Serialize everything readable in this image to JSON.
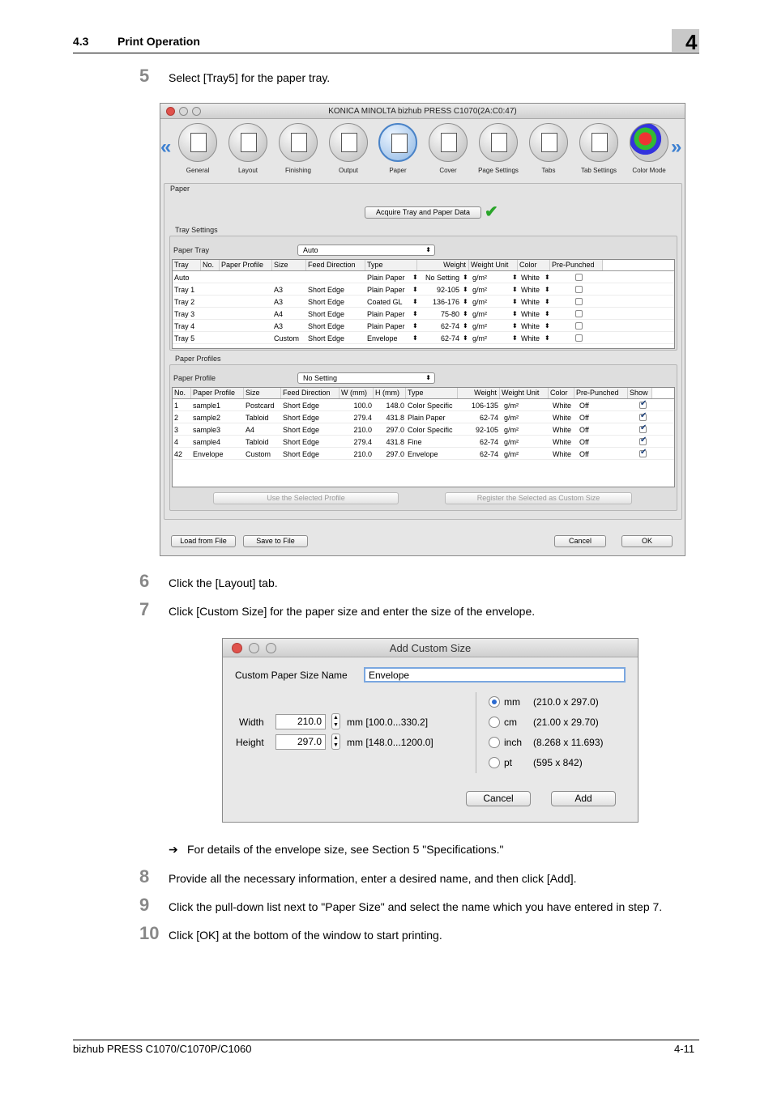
{
  "header": {
    "section": "4.3",
    "title": "Print Operation",
    "chapter": "4"
  },
  "steps": [
    {
      "num": "5",
      "text": "Select [Tray5] for the paper tray."
    },
    {
      "num": "6",
      "text": "Click the [Layout] tab."
    },
    {
      "num": "7",
      "text": "Click [Custom Size] for the paper size and enter the size of the envelope."
    },
    {
      "num": "8",
      "text": "Provide all the necessary information, enter a desired name, and then click [Add]."
    },
    {
      "num": "9",
      "text": "Click the pull-down list next to \"Paper Size\" and select the name which you have entered in step 7."
    },
    {
      "num": "10",
      "text": "Click [OK] at the bottom of the window to start printing."
    }
  ],
  "note": {
    "arrow": "➔",
    "text": "For details of the envelope size, see Section 5 \"Specifications.\""
  },
  "window": {
    "title": "KONICA MINOLTA bizhub PRESS C1070(2A:C0:47)",
    "tabs": [
      "General",
      "Layout",
      "Finishing",
      "Output",
      "Paper",
      "Cover",
      "Page Settings",
      "Tabs",
      "Tab Settings",
      "Color Mode"
    ],
    "selected_tab": "Paper",
    "paper_group": "Paper",
    "acquire_button": "Acquire Tray and Paper Data",
    "tray_settings_label": "Tray Settings",
    "paper_tray_label": "Paper Tray",
    "paper_tray_value": "Auto",
    "tray_columns": [
      "Tray",
      "No.",
      "Paper Profile",
      "Size",
      "Feed Direction",
      "Type",
      "Weight",
      "Weight Unit",
      "Color",
      "Pre-Punched"
    ],
    "tray_rows": [
      {
        "tray": "Auto",
        "no": "",
        "profile": "",
        "size": "",
        "feed": "",
        "type": "Plain Paper",
        "weight": "No Setting",
        "unit": "g/m²",
        "color": "White"
      },
      {
        "tray": "Tray 1",
        "no": "",
        "profile": "",
        "size": "A3",
        "feed": "Short Edge",
        "type": "Plain Paper",
        "weight": "92-105",
        "unit": "g/m²",
        "color": "White"
      },
      {
        "tray": "Tray 2",
        "no": "",
        "profile": "",
        "size": "A3",
        "feed": "Short Edge",
        "type": "Coated GL",
        "weight": "136-176",
        "unit": "g/m²",
        "color": "White"
      },
      {
        "tray": "Tray 3",
        "no": "",
        "profile": "",
        "size": "A4",
        "feed": "Short Edge",
        "type": "Plain Paper",
        "weight": "75-80",
        "unit": "g/m²",
        "color": "White"
      },
      {
        "tray": "Tray 4",
        "no": "",
        "profile": "",
        "size": "A3",
        "feed": "Short Edge",
        "type": "Plain Paper",
        "weight": "62-74",
        "unit": "g/m²",
        "color": "White"
      },
      {
        "tray": "Tray 5",
        "no": "",
        "profile": "",
        "size": "Custom",
        "feed": "Short Edge",
        "type": "Envelope",
        "weight": "62-74",
        "unit": "g/m²",
        "color": "White"
      }
    ],
    "paper_profiles_label": "Paper Profiles",
    "paper_profile_label": "Paper Profile",
    "paper_profile_value": "No Setting",
    "profile_columns": [
      "No.",
      "Paper Profile",
      "Size",
      "Feed Direction",
      "W (mm)",
      "H (mm)",
      "Type",
      "Weight",
      "Weight Unit",
      "Color",
      "Pre-Punched",
      "Show"
    ],
    "profile_rows": [
      {
        "no": "1",
        "name": "sample1",
        "size": "Postcard",
        "feed": "Short Edge",
        "w": "100.0",
        "h": "148.0",
        "type": "Color Specific",
        "weight": "106-135",
        "unit": "g/m²",
        "color": "White",
        "punched": "Off"
      },
      {
        "no": "2",
        "name": "sample2",
        "size": "Tabloid",
        "feed": "Short Edge",
        "w": "279.4",
        "h": "431.8",
        "type": "Plain Paper",
        "weight": "62-74",
        "unit": "g/m²",
        "color": "White",
        "punched": "Off"
      },
      {
        "no": "3",
        "name": "sample3",
        "size": "A4",
        "feed": "Short Edge",
        "w": "210.0",
        "h": "297.0",
        "type": "Color Specific",
        "weight": "92-105",
        "unit": "g/m²",
        "color": "White",
        "punched": "Off"
      },
      {
        "no": "4",
        "name": "sample4",
        "size": "Tabloid",
        "feed": "Short Edge",
        "w": "279.4",
        "h": "431.8",
        "type": "Fine",
        "weight": "62-74",
        "unit": "g/m²",
        "color": "White",
        "punched": "Off"
      },
      {
        "no": "42",
        "name": "Envelope",
        "size": "Custom",
        "feed": "Short Edge",
        "w": "210.0",
        "h": "297.0",
        "type": "Envelope",
        "weight": "62-74",
        "unit": "g/m²",
        "color": "White",
        "punched": "Off"
      }
    ],
    "use_profile_button": "Use the Selected Profile",
    "register_button": "Register the Selected as Custom Size",
    "load_button": "Load from File",
    "save_button": "Save to File",
    "cancel_button": "Cancel",
    "ok_button": "OK"
  },
  "dialog": {
    "title": "Add Custom Size",
    "name_label": "Custom Paper Size Name",
    "name_value": "Envelope",
    "width_label": "Width",
    "width_value": "210.0",
    "width_range": "mm [100.0...330.2]",
    "height_label": "Height",
    "height_value": "297.0",
    "height_range": "mm [148.0...1200.0]",
    "units": [
      {
        "label": "mm",
        "value": "(210.0 x 297.0)",
        "selected": true
      },
      {
        "label": "cm",
        "value": "(21.00 x 29.70)",
        "selected": false
      },
      {
        "label": "inch",
        "value": "(8.268 x 11.693)",
        "selected": false
      },
      {
        "label": "pt",
        "value": "(595 x 842)",
        "selected": false
      }
    ],
    "cancel_button": "Cancel",
    "add_button": "Add"
  },
  "footer": {
    "product": "bizhub PRESS C1070/C1070P/C1060",
    "page": "4-11"
  }
}
